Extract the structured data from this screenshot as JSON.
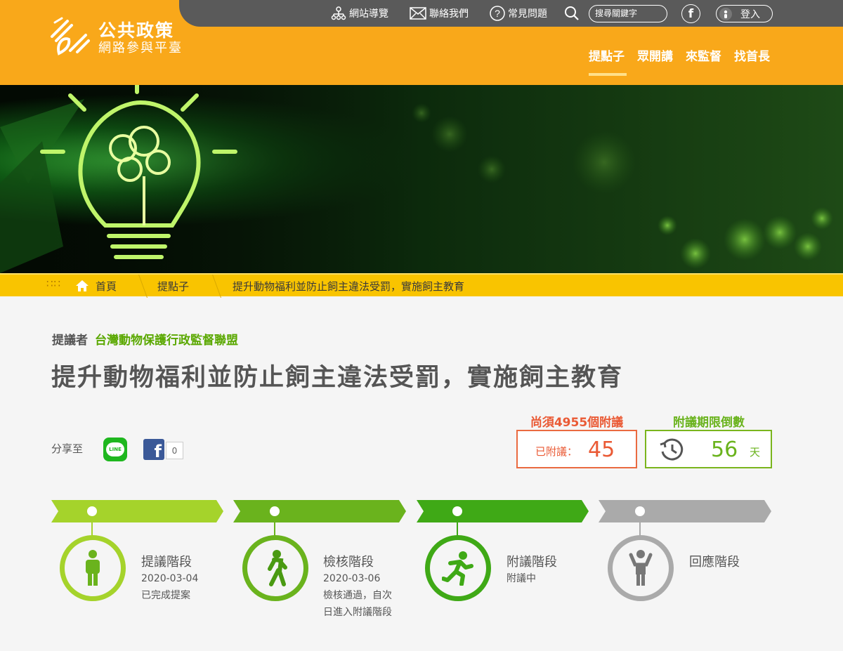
{
  "header": {
    "logo_title": "公共政策",
    "logo_subtitle": "網路參與平臺",
    "top_links": {
      "sitemap": "網站導覽",
      "contact": "聯絡我們",
      "faq": "常見問題"
    },
    "search_placeholder": "搜尋關鍵字",
    "login": "登入",
    "nav": [
      "提點子",
      "眾開講",
      "來監督",
      "找首長"
    ]
  },
  "breadcrumb": {
    "home": "首頁",
    "section": "提點子",
    "current": "提升動物福利並防止飼主違法受罰，實施飼主教育"
  },
  "proposal": {
    "proposer_label": "提議者",
    "proposer": "台灣動物保護行政監督聯盟",
    "title": "提升動物福利並防止飼主違法受罰，實施飼主教育",
    "share_label": "分享至",
    "line_label": "LINE",
    "fb_count": "0"
  },
  "stats": {
    "need_label": "尚須4955個附議",
    "signed_label": "已附議：",
    "signed_count": "45",
    "countdown_label": "附議期限倒數",
    "days": "56",
    "days_unit": "天"
  },
  "stages": [
    {
      "name": "提議階段",
      "date": "2020-03-04",
      "status": "已完成提案"
    },
    {
      "name": "檢核階段",
      "date": "2020-03-06",
      "status_line1": "檢核通過，自次",
      "status_line2": "日進入附議階段"
    },
    {
      "name": "附議階段",
      "status": "附議中"
    },
    {
      "name": "回應階段"
    }
  ],
  "colors": {
    "header": "#f9a81a",
    "stage1": "#a5d32b",
    "stage2": "#6ab31d",
    "stage3": "#3fa916",
    "stage4": "#aaaaaa"
  }
}
